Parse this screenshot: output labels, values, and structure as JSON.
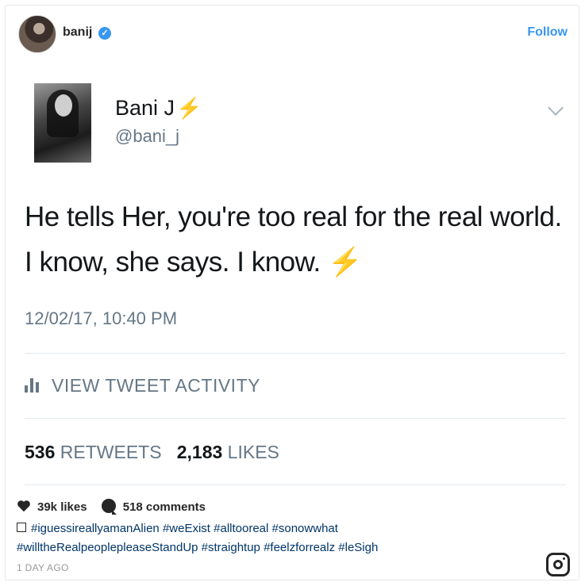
{
  "post": {
    "username": "banij",
    "follow_label": "Follow"
  },
  "tweet": {
    "display_name": "Bani J",
    "handle": "@bani_j",
    "text": "He tells Her, you're too real for the real world. I know, she says. I know.",
    "bolt_glyph": "⚡",
    "timestamp": "12/02/17, 10:40 PM",
    "activity_label": "VIEW TWEET ACTIVITY",
    "retweets_count": "536",
    "retweets_label": "RETWEETS",
    "likes_count": "2,183",
    "likes_label": "LIKES"
  },
  "footer": {
    "likes": "39k likes",
    "comments": "518 comments",
    "hashtags": [
      "#iguessireallyamanAlien",
      "#weExist",
      "#alltooreal",
      "#sonowwhat",
      "#willtheRealpeoplepleaseStandUp",
      "#straightup",
      "#feelzforrealz",
      "#leSigh"
    ],
    "time_ago": "1 DAY AGO"
  },
  "colors": {
    "accent": "#3897f0",
    "bolt": "#f5c242",
    "muted": "#657786"
  }
}
